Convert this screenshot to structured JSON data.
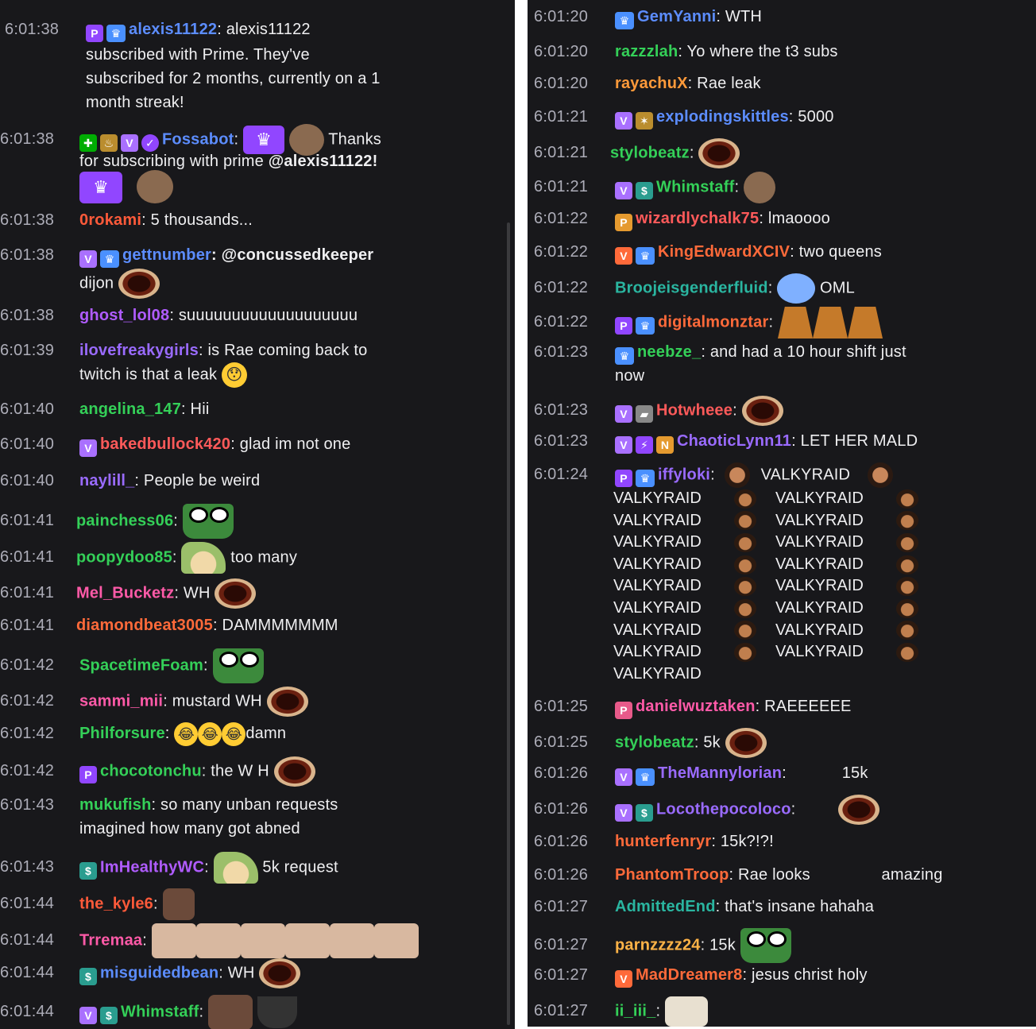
{
  "left_panel": {
    "messages": [
      {
        "ts": "6:01:38",
        "badges": [
          "prime",
          "crown"
        ],
        "user": "alexis11122",
        "color": "#5c8dff",
        "lines": [
          ": alexis11122",
          "subscribed with Prime. They've",
          "subscribed for 2 months, currently on a 1",
          "month streak!"
        ]
      },
      {
        "ts": "6:01:38",
        "badges": [
          "mod",
          "bits",
          "shield",
          "verify"
        ],
        "user": "Fossabot",
        "color": "#5c8dff",
        "text": ":",
        "after": "Thanks",
        "line2": "for subscribing with prime",
        "mention": "@alexis11122!"
      },
      {
        "ts": "6:01:38",
        "user": "0rokami",
        "color": "#ff5a3a",
        "text": ": 5 thousands..."
      },
      {
        "ts": "6:01:38",
        "badges": [
          "shield",
          "crown"
        ],
        "user": "gettnumber",
        "color": "#5c8dff",
        "text": ": @concussedkeeper",
        "line2": "dijon"
      },
      {
        "ts": "6:01:38",
        "user": "ghost_lol08",
        "color": "#b05cff",
        "text": ": suuuuuuuuuuuuuuuuuuu"
      },
      {
        "ts": "6:01:39",
        "user": "ilovefreakygirls",
        "color": "#9a6bff",
        "text": ": is Rae coming back to",
        "line2": "twitch is that a leak"
      },
      {
        "ts": "6:01:40",
        "user": "angelina_147",
        "color": "#34d058",
        "text": ": Hii"
      },
      {
        "ts": "6:01:40",
        "badges": [
          "shield"
        ],
        "user": "bakedbullock420",
        "color": "#ff5a5a",
        "text": ": glad im not one"
      },
      {
        "ts": "6:01:40",
        "user": "naylill_",
        "color": "#9a6bff",
        "text": ": People be weird"
      },
      {
        "ts": "6:01:41",
        "user": "painchess06",
        "color": "#34d058",
        "text": ":"
      },
      {
        "ts": "6:01:41",
        "user": "poopydoo85",
        "color": "#34d058",
        "text": ":",
        "after": "too many"
      },
      {
        "ts": "6:01:41",
        "user": "Mel_Bucketz",
        "color": "#ff5aa8",
        "text": ": WH"
      },
      {
        "ts": "6:01:41",
        "user": "diamondbeat3005",
        "color": "#ff6a3a",
        "text": ": DAMMMMMMM"
      },
      {
        "ts": "6:01:42",
        "user": "SpacetimeFoam",
        "color": "#34d058",
        "text": ":"
      },
      {
        "ts": "6:01:42",
        "user": "sammi_mii",
        "color": "#ff5aa8",
        "text": ": mustard WH"
      },
      {
        "ts": "6:01:42",
        "user": "Philforsure",
        "color": "#34d058",
        "text": ":",
        "after": "damn"
      },
      {
        "ts": "6:01:42",
        "badges": [
          "prime"
        ],
        "user": "chocotonchu",
        "color": "#34d058",
        "text": ": the W H"
      },
      {
        "ts": "6:01:43",
        "user": "mukufish",
        "color": "#34d058",
        "text": ": so many unban requests",
        "line2": "imagined how many got abned"
      },
      {
        "ts": "6:01:43",
        "badges": [
          "gift"
        ],
        "user": "ImHealthyWC",
        "color": "#b05cff",
        "text": ":",
        "after": "5k request"
      },
      {
        "ts": "6:01:44",
        "user": "the_kyle6",
        "color": "#ff5a3a",
        "text": ":"
      },
      {
        "ts": "6:01:44",
        "user": "Trremaa",
        "color": "#ff5aa8",
        "text": ":"
      },
      {
        "ts": "6:01:44",
        "badges": [
          "gift"
        ],
        "user": "misguidedbean",
        "color": "#5c8dff",
        "text": ": WH"
      },
      {
        "ts": "6:01:44",
        "badges": [
          "shield",
          "gift"
        ],
        "user": "Whimstaff",
        "color": "#34d058",
        "text": ":"
      }
    ]
  },
  "right_panel": {
    "messages": [
      {
        "ts": "6:01:20",
        "badges": [
          "crown"
        ],
        "user": "GemYanni",
        "color": "#5c8dff",
        "text": ": WTH"
      },
      {
        "ts": "6:01:20",
        "user": "razzzlah",
        "color": "#34d058",
        "text": ": Yo where the t3 subs"
      },
      {
        "ts": "6:01:20",
        "user": "rayachuX",
        "color": "#ff9a3a",
        "text": ": Rae leak"
      },
      {
        "ts": "6:01:21",
        "badges": [
          "shield",
          "bits"
        ],
        "user": "explodingskittles",
        "color": "#5c8dff",
        "text": ": 5000"
      },
      {
        "ts": "6:01:21",
        "user": "stylobeatz",
        "color": "#34d058",
        "text": ":"
      },
      {
        "ts": "6:01:21",
        "badges": [
          "shield",
          "gift"
        ],
        "user": "Whimstaff",
        "color": "#34d058",
        "text": ":"
      },
      {
        "ts": "6:01:22",
        "badges": [
          "founder"
        ],
        "user": "wizardlychalk75",
        "color": "#ff5a5a",
        "text": ": lmaoooo"
      },
      {
        "ts": "6:01:22",
        "badges": [
          "shield",
          "crown"
        ],
        "user": "KingEdwardXCIV",
        "color": "#ff6a3a",
        "text": ": two queens"
      },
      {
        "ts": "6:01:22",
        "user": "Broojeisgenderfluid",
        "color": "#2ab5a0",
        "text": ":",
        "after": "OML"
      },
      {
        "ts": "6:01:22",
        "badges": [
          "prime",
          "crown"
        ],
        "user": "digitalmonztar",
        "color": "#ff6a3a",
        "text": ":"
      },
      {
        "ts": "6:01:23",
        "badges": [
          "crown"
        ],
        "user": "neebze_",
        "color": "#34d058",
        "text": ": and had a 10 hour shift just",
        "line2": "now"
      },
      {
        "ts": "6:01:23",
        "badges": [
          "shield",
          "bits"
        ],
        "user": "Hotwheee",
        "color": "#ff5a5a",
        "text": ":"
      },
      {
        "ts": "6:01:23",
        "badges": [
          "shield",
          "prime",
          "founder"
        ],
        "user": "ChaoticLynn11",
        "color": "#9a6bff",
        "text": ": LET HER MALD"
      },
      {
        "ts": "6:01:24",
        "badges": [
          "prime",
          "crown"
        ],
        "user": "iffyloki",
        "color": "#9a6bff",
        "text": ":",
        "after": "VALKYRAID",
        "valkyraid_rows": [
          [
            "VALKYRAID",
            "VALKYRAID"
          ],
          [
            "VALKYRAID",
            "VALKYRAID"
          ],
          [
            "VALKYRAID",
            "VALKYRAID"
          ],
          [
            "VALKYRAID",
            "VALKYRAID"
          ],
          [
            "VALKYRAID",
            "VALKYRAID"
          ],
          [
            "VALKYRAID",
            "VALKYRAID"
          ],
          [
            "VALKYRAID",
            "VALKYRAID"
          ],
          [
            "VALKYRAID",
            "VALKYRAID"
          ],
          [
            "VALKYRAID"
          ]
        ]
      },
      {
        "ts": "6:01:25",
        "badges": [
          "prime"
        ],
        "user": "danielwuztaken",
        "color": "#ff5aa8",
        "text": ": RAEEEEEE"
      },
      {
        "ts": "6:01:25",
        "user": "stylobeatz",
        "color": "#34d058",
        "text": ": 5k"
      },
      {
        "ts": "6:01:26",
        "badges": [
          "shield",
          "crown"
        ],
        "user": "TheMannylorian",
        "color": "#9a6bff",
        "text": ":",
        "after": "15k"
      },
      {
        "ts": "6:01:26",
        "badges": [
          "shield",
          "gift"
        ],
        "user": "Locothepocoloco",
        "color": "#9a6bff",
        "text": ":"
      },
      {
        "ts": "6:01:26",
        "user": "hunterfenryr",
        "color": "#ff6a3a",
        "text": ": 15k?!?!"
      },
      {
        "ts": "6:01:26",
        "user": "PhantomTroop",
        "color": "#ff6a3a",
        "text": ": Rae looks",
        "after": "amazing"
      },
      {
        "ts": "6:01:27",
        "user": "AdmittedEnd",
        "color": "#2ab5a0",
        "text": ": that's insane hahaha"
      },
      {
        "ts": "6:01:27",
        "user": "parnzzzz24",
        "color": "#ffb347",
        "text": ": 15k"
      },
      {
        "ts": "6:01:27",
        "badges": [
          "shield"
        ],
        "user": "MadDreamer8",
        "color": "#ff6a3a",
        "text": ": jesus christ holy"
      },
      {
        "ts": "6:01:27",
        "user": "ii_iii_",
        "color": "#34d058",
        "text": ":"
      }
    ]
  }
}
